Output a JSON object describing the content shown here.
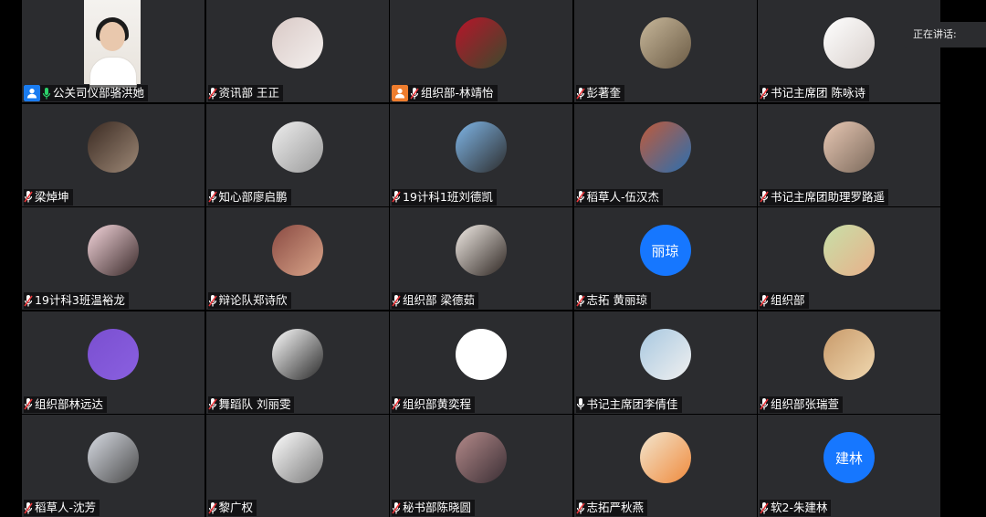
{
  "speaking_label": "正在讲话:",
  "participants": [
    {
      "name": "公关司仪部骆洪她",
      "video": true,
      "badge": "#1a7cf0",
      "mic": "green"
    },
    {
      "name": "资讯部 王正",
      "avatar_colors": [
        "#d9c9c6",
        "#f4f0ee"
      ],
      "mic": "muted"
    },
    {
      "name": "组织部-林靖怡",
      "avatar_colors": [
        "#b8142a",
        "#3b4a2c"
      ],
      "badge": "#ee7d2e",
      "mic": "muted"
    },
    {
      "name": "彭著奎",
      "avatar_colors": [
        "#c7b79a",
        "#6b5b45"
      ],
      "mic": "muted"
    },
    {
      "name": "书记主席团 陈咏诗",
      "avatar_colors": [
        "#ffffff",
        "#d8d0cc"
      ],
      "mic": "muted"
    },
    {
      "name": "梁焯坤",
      "avatar_colors": [
        "#3a2a22",
        "#9d8876"
      ],
      "mic": "muted"
    },
    {
      "name": "知心部廖启鹏",
      "avatar_colors": [
        "#eeeeee",
        "#9a9a9a"
      ],
      "mic": "muted"
    },
    {
      "name": "19计科1班刘德凯",
      "avatar_colors": [
        "#7fb6e8",
        "#2d2d2d"
      ],
      "mic": "muted"
    },
    {
      "name": "稻草人-伍汉杰",
      "avatar_colors": [
        "#c05a3a",
        "#2b6fb0"
      ],
      "mic": "muted"
    },
    {
      "name": "书记主席团助理罗路遥",
      "avatar_colors": [
        "#e8c8b4",
        "#7c6a5c"
      ],
      "mic": "muted"
    },
    {
      "name": "19计科3班温裕龙",
      "avatar_colors": [
        "#f5d6dc",
        "#3a2a2a"
      ],
      "mic": "muted"
    },
    {
      "name": "辩论队郑诗欣",
      "avatar_colors": [
        "#8a4a42",
        "#d9a58a"
      ],
      "mic": "muted"
    },
    {
      "name": "组织部 梁德茹",
      "avatar_colors": [
        "#f2ece6",
        "#2e2622"
      ],
      "mic": "muted"
    },
    {
      "name": "志拓 黄丽琼",
      "avatar_text": "丽琼",
      "avatar_colors": [
        "#1677ff",
        "#1677ff"
      ],
      "mic": "muted"
    },
    {
      "name": "组织部",
      "avatar_colors": [
        "#c7e0a8",
        "#e8b08a"
      ],
      "mic": "muted"
    },
    {
      "name": "组织部林远达",
      "avatar_colors": [
        "#7a4fd0",
        "#8a60e0"
      ],
      "mic": "muted"
    },
    {
      "name": "舞蹈队 刘丽雯",
      "avatar_colors": [
        "#ffffff",
        "#2a2a2a"
      ],
      "mic": "muted"
    },
    {
      "name": "组织部黄奕程",
      "avatar_colors": [
        "#ffffff",
        "#ffffff"
      ],
      "mic": "muted"
    },
    {
      "name": "书记主席团李倩佳",
      "avatar_colors": [
        "#a8c8e0",
        "#f0f0f0"
      ],
      "mic": "white"
    },
    {
      "name": "组织部张瑞萱",
      "avatar_colors": [
        "#c89a6a",
        "#f0d8b0"
      ],
      "mic": "muted"
    },
    {
      "name": "稻草人-沈芳",
      "avatar_colors": [
        "#d8dce4",
        "#4a4a4a"
      ],
      "mic": "muted"
    },
    {
      "name": "黎广权",
      "avatar_colors": [
        "#ffffff",
        "#7a7a7a"
      ],
      "mic": "muted"
    },
    {
      "name": "秘书部陈晓圆",
      "avatar_colors": [
        "#b48a8a",
        "#3a2e34"
      ],
      "mic": "muted"
    },
    {
      "name": "志拓严秋燕",
      "avatar_colors": [
        "#f2e6cf",
        "#f08a3c"
      ],
      "mic": "muted"
    },
    {
      "name": "软2-朱建林",
      "avatar_text": "建林",
      "avatar_colors": [
        "#1677ff",
        "#1677ff"
      ],
      "mic": "muted"
    }
  ]
}
